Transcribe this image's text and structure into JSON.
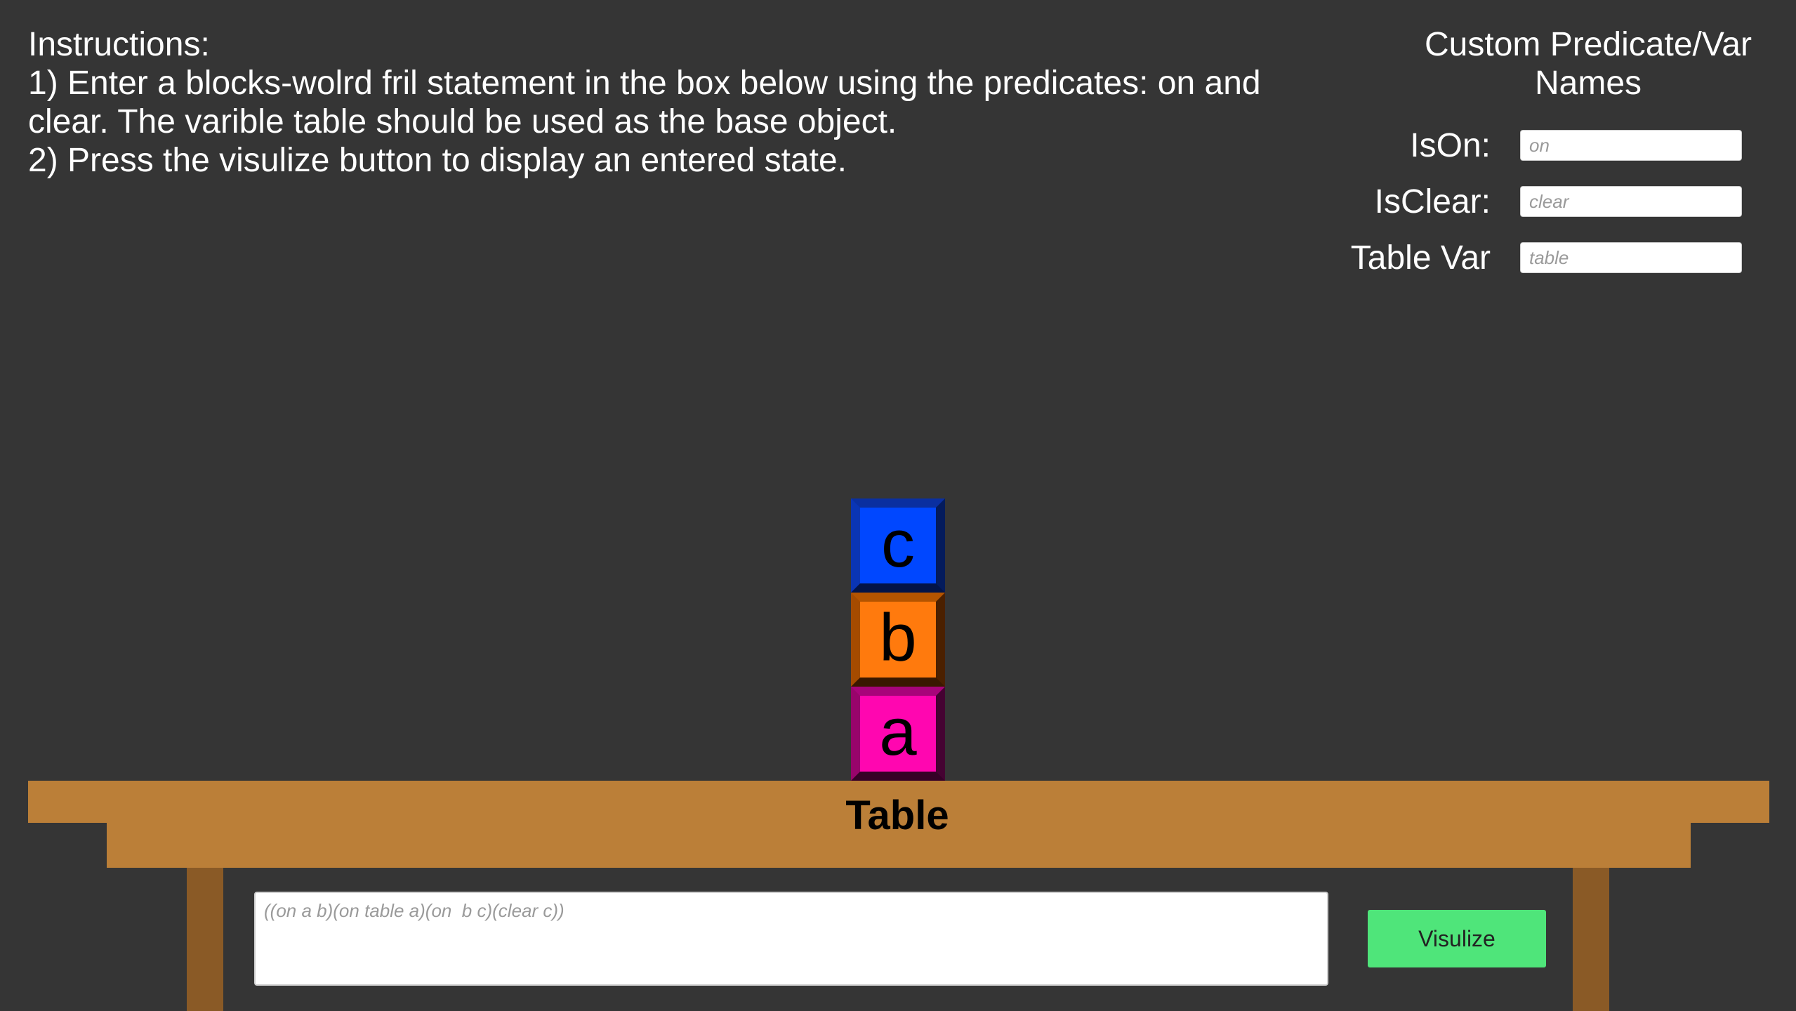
{
  "instructions": {
    "heading": "Instructions:",
    "step1": "1) Enter a blocks-wolrd fril statement in the box below using the predicates: on and clear. The varible table should be used as the base object.",
    "step2": "2) Press the visulize button to display an entered state."
  },
  "custom_panel": {
    "title": "Custom Predicate/Var Names",
    "fields": [
      {
        "label": "IsOn:",
        "placeholder": "on"
      },
      {
        "label": "IsClear:",
        "placeholder": "clear"
      },
      {
        "label": "Table Var",
        "placeholder": "table"
      }
    ]
  },
  "blocks": [
    {
      "letter": "c",
      "color": "#0047ff"
    },
    {
      "letter": "b",
      "color": "#ff7a0d"
    },
    {
      "letter": "a",
      "color": "#ff06b0"
    }
  ],
  "table": {
    "label": "Table",
    "color": "#bb7f38",
    "leg_color": "#8a5a26"
  },
  "statement": {
    "placeholder": "((on a b)(on table a)(on  b c)(clear c))",
    "value": ""
  },
  "visualize_button": {
    "label": "Visulize",
    "color": "#4fe57a"
  },
  "background_color": "#353535"
}
